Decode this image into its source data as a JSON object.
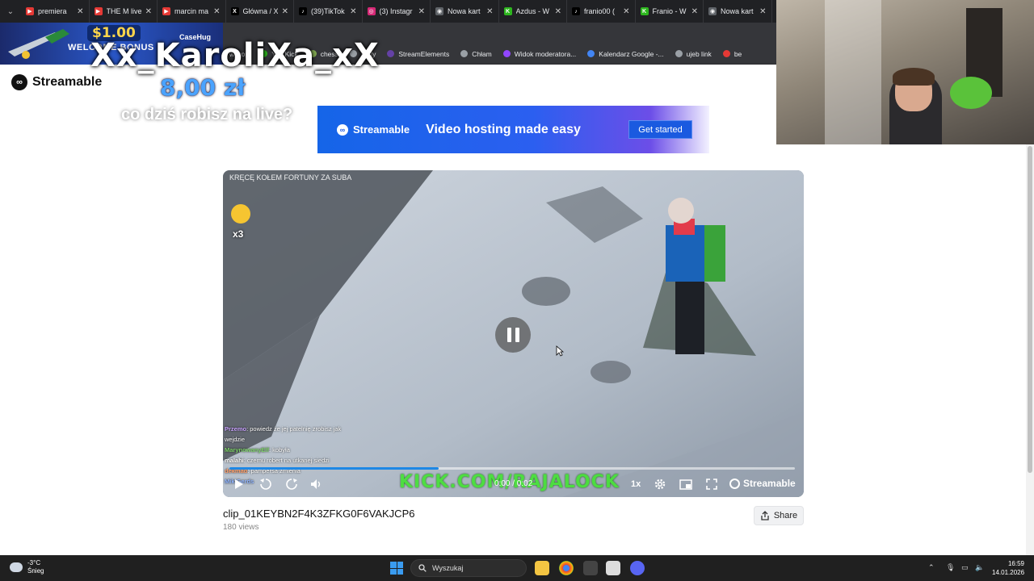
{
  "browser": {
    "tabs": [
      {
        "title": "premiera",
        "color": "#e53935",
        "glyph": "▶"
      },
      {
        "title": "THE M live",
        "color": "#e53935",
        "glyph": "▶"
      },
      {
        "title": "marcin ma",
        "color": "#e53935",
        "glyph": "▶"
      },
      {
        "title": "Główna / X",
        "color": "#000000",
        "glyph": "X"
      },
      {
        "title": "(39)TikTok",
        "color": "#000000",
        "glyph": "♪"
      },
      {
        "title": "(3) Instagr",
        "color": "#d62976",
        "glyph": "◎"
      },
      {
        "title": "Nowa kart",
        "color": "#5f6368",
        "glyph": "◉"
      },
      {
        "title": "Azdus - W",
        "color": "#2db61e",
        "glyph": "K"
      },
      {
        "title": "franio00 (",
        "color": "#000000",
        "glyph": "♪"
      },
      {
        "title": "Franio - W",
        "color": "#2db61e",
        "glyph": "K"
      },
      {
        "title": "Nowa kart",
        "color": "#5f6368",
        "glyph": "◉"
      }
    ],
    "bookmarks": [
      {
        "label": "wykop",
        "color": "#1d7ed6"
      },
      {
        "label": "Yo | Kick",
        "color": "#2db61e"
      },
      {
        "label": "chess",
        "color": "#7fa650"
      },
      {
        "label": "nudy",
        "color": "#9aa0a6"
      },
      {
        "label": "StreamElements",
        "color": "#6441a5"
      },
      {
        "label": "Chłam",
        "color": "#9aa0a6"
      },
      {
        "label": "Widok moderatora...",
        "color": "#9146ff"
      },
      {
        "label": "Kalendarz Google -...",
        "color": "#4285f4"
      },
      {
        "label": "ujeb link",
        "color": "#9aa0a6"
      },
      {
        "label": "be",
        "color": "#e53935"
      }
    ]
  },
  "overlay": {
    "promo_price": "$1.00",
    "promo_bonus": "WELCOME BONUS",
    "promo_brand": "CaseHug",
    "donor_name": "Xx_KaroliXa_xX",
    "donation_amount": "8,00 zł",
    "donation_message": "co dziś robisz na live?"
  },
  "site": {
    "logo_text": "Streamable"
  },
  "ad": {
    "brand": "Streamable",
    "tagline": "Video hosting made easy",
    "cta": "Get started"
  },
  "video": {
    "caption": "KRĘCĘ KOŁEM FORTUNY ZA SUBA",
    "emote_multiplier": "x3",
    "chat": [
      {
        "user": "Przemo",
        "text": ": powiedz że jej patelnię zrobisz jak wejdzie"
      },
      {
        "user": "MarynowanyElf",
        "text": ": kobyła"
      },
      {
        "user": "malahi",
        "text": ": czemu robert na utkanej siedzi"
      },
      {
        "user": "dekmad",
        "text": ": pampersa zmienia"
      },
      {
        "user": "MikiGerds",
        "text": ""
      }
    ],
    "watermark": "KICK.COM/RAJALOCK",
    "time": "0:00 / 0:02",
    "speed": "1x",
    "brand": "Streamable",
    "progress_buffered": 0.37,
    "accent": "#1e88e5"
  },
  "clip": {
    "title": "clip_01KEYBN2F4K3ZFKG0F6VAKJCP6",
    "views": "180 views",
    "share_label": "Share"
  },
  "taskbar": {
    "temperature": "-3°C",
    "weather": "Śnieg",
    "search_placeholder": "Wyszukaj",
    "time": "16:59",
    "date": "14.01.2026"
  }
}
